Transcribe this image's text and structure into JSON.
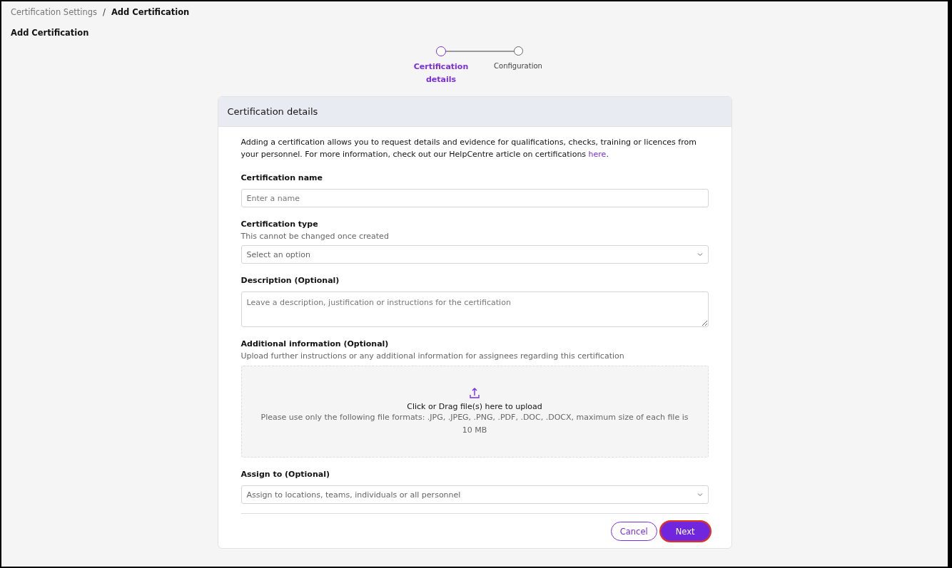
{
  "breadcrumb": [
    {
      "label": "Certification Settings",
      "current": false
    },
    {
      "label": "Add Certification",
      "current": true
    }
  ],
  "breadcrumb_separator": "/",
  "page_title": "Add Certification",
  "stepper": [
    {
      "label": "Certification details",
      "selected": true
    },
    {
      "label": "Configuration",
      "selected": false
    }
  ],
  "card": {
    "title": "Certification details",
    "intro": {
      "text": "Adding a certification allows you to request details and evidence for qualifications, checks, training or licences from your personnel. For more information, check out our HelpCentre article on certifications ",
      "link": "here",
      "after": "."
    },
    "fields": [
      {
        "kind": "text",
        "label": "Certification name",
        "placeholder": "Enter a name"
      },
      {
        "kind": "select",
        "label": "Certification type",
        "hint": "This cannot be changed once created",
        "placeholder": "Select an option"
      },
      {
        "kind": "textarea",
        "label": "Description (Optional)",
        "placeholder": "Leave a description, justification or instructions for the certification"
      },
      {
        "kind": "upload",
        "label": "Additional information (Optional)",
        "hint": "Upload further instructions or any additional information for assignees regarding this certification",
        "title": "Click or Drag file(s) here to upload",
        "note": "Please use only the following file formats: .JPG, .JPEG, .PNG, .PDF, .DOC, .DOCX, maximum size of each file is 10 MB"
      },
      {
        "kind": "select",
        "label": "Assign to (Optional)",
        "placeholder": "Assign to locations, teams, individuals or all personnel"
      }
    ],
    "buttons": [
      {
        "label": "Cancel",
        "kind": "secondary",
        "focused": false
      },
      {
        "label": "Next",
        "kind": "primary",
        "focused": true
      }
    ]
  }
}
